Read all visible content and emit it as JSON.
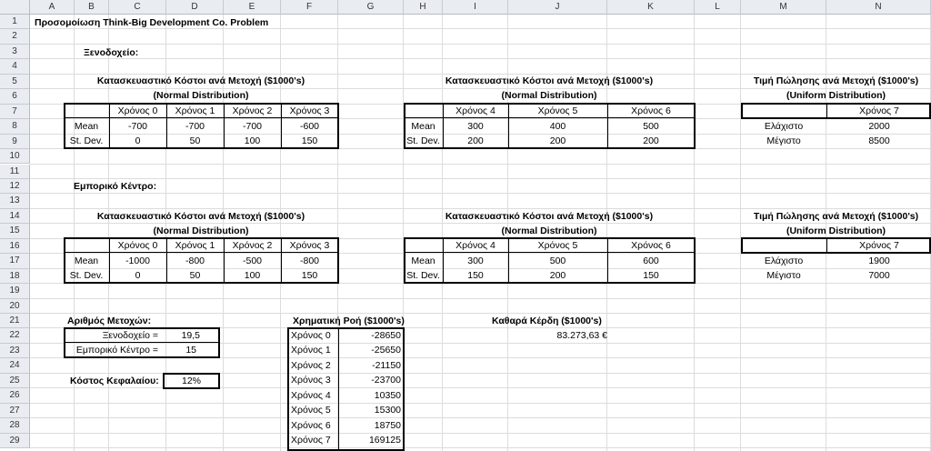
{
  "sheet": {
    "columns": [
      "A",
      "B",
      "C",
      "D",
      "E",
      "F",
      "G",
      "H",
      "I",
      "J",
      "K",
      "L",
      "M",
      "N"
    ],
    "rows": [
      "1",
      "2",
      "3",
      "4",
      "5",
      "6",
      "7",
      "8",
      "9",
      "10",
      "11",
      "12",
      "13",
      "14",
      "15",
      "16",
      "17",
      "18",
      "19",
      "20",
      "21",
      "22",
      "23",
      "24",
      "25",
      "26",
      "27",
      "28",
      "29"
    ]
  },
  "title": "Προσομοίωση Think-Big Development Co. Problem",
  "hotel": {
    "label": "Ξενοδοχείο:",
    "cost_title": "Κατασκευαστικό Κόστοι ανά Μετοχή ($1000's)",
    "normal_dist": "(Normal Distribution)",
    "table1": {
      "headers": [
        "Χρόνος 0",
        "Χρόνος 1",
        "Χρόνος 2",
        "Χρόνος 3"
      ],
      "mean_label": "Mean",
      "sd_label": "St. Dev.",
      "mean": [
        "-700",
        "-700",
        "-700",
        "-600"
      ],
      "sd": [
        "0",
        "50",
        "100",
        "150"
      ]
    },
    "table2": {
      "headers": [
        "Χρόνος 4",
        "Χρόνος 5",
        "Χρόνος 6"
      ],
      "mean_label": "Mean",
      "sd_label": "St. Dev.",
      "mean": [
        "300",
        "400",
        "500"
      ],
      "sd": [
        "200",
        "200",
        "200"
      ]
    },
    "sale_title": "Τιμή Πώλησης ανά Μετοχή ($1000's)",
    "uniform_dist": "(Uniform Distribution)",
    "table3": {
      "header": "Χρόνος 7",
      "min_label": "Ελάχιστο",
      "max_label": "Μέγιστο",
      "min": "2000",
      "max": "8500"
    }
  },
  "mall": {
    "label": "Εμπορικό Κέντρο:",
    "cost_title": "Κατασκευαστικό Κόστοι ανά Μετοχή ($1000's)",
    "normal_dist": "(Normal Distribution)",
    "table1": {
      "headers": [
        "Χρόνος 0",
        "Χρόνος 1",
        "Χρόνος 2",
        "Χρόνος 3"
      ],
      "mean_label": "Mean",
      "sd_label": "St. Dev.",
      "mean": [
        "-1000",
        "-800",
        "-500",
        "-800"
      ],
      "sd": [
        "0",
        "50",
        "100",
        "150"
      ]
    },
    "table2": {
      "headers": [
        "Χρόνος 4",
        "Χρόνος 5",
        "Χρόνος 6"
      ],
      "mean_label": "Mean",
      "sd_label": "St. Dev.",
      "mean": [
        "300",
        "500",
        "600"
      ],
      "sd": [
        "150",
        "200",
        "150"
      ]
    },
    "sale_title": "Τιμή Πώλησης ανά Μετοχή ($1000's)",
    "uniform_dist": "(Uniform Distribution)",
    "table3": {
      "header": "Χρόνος 7",
      "min_label": "Ελάχιστο",
      "max_label": "Μέγιστο",
      "min": "1900",
      "max": "7000"
    }
  },
  "shares": {
    "title": "Αριθμός Μετοχών:",
    "hotel_label": "Ξενοδοχείο =",
    "hotel_value": "19,5",
    "mall_label": "Εμπορικό Κέντρο =",
    "mall_value": "15",
    "capital_label": "Κόστος Κεφαλαίου:",
    "capital_value": "12%"
  },
  "cashflow": {
    "title": "Χρηματική Ροή ($1000's)",
    "rows": [
      {
        "label": "Χρόνος 0",
        "value": "-28650"
      },
      {
        "label": "Χρόνος 1",
        "value": "-25650"
      },
      {
        "label": "Χρόνος 2",
        "value": "-21150"
      },
      {
        "label": "Χρόνος 3",
        "value": "-23700"
      },
      {
        "label": "Χρόνος 4",
        "value": "10350"
      },
      {
        "label": "Χρόνος 5",
        "value": "15300"
      },
      {
        "label": "Χρόνος 6",
        "value": "18750"
      },
      {
        "label": "Χρόνος 7",
        "value": "169125"
      }
    ]
  },
  "profit": {
    "title": "Καθαρά Κέρδη ($1000's)",
    "value": "83.273,63 €"
  }
}
